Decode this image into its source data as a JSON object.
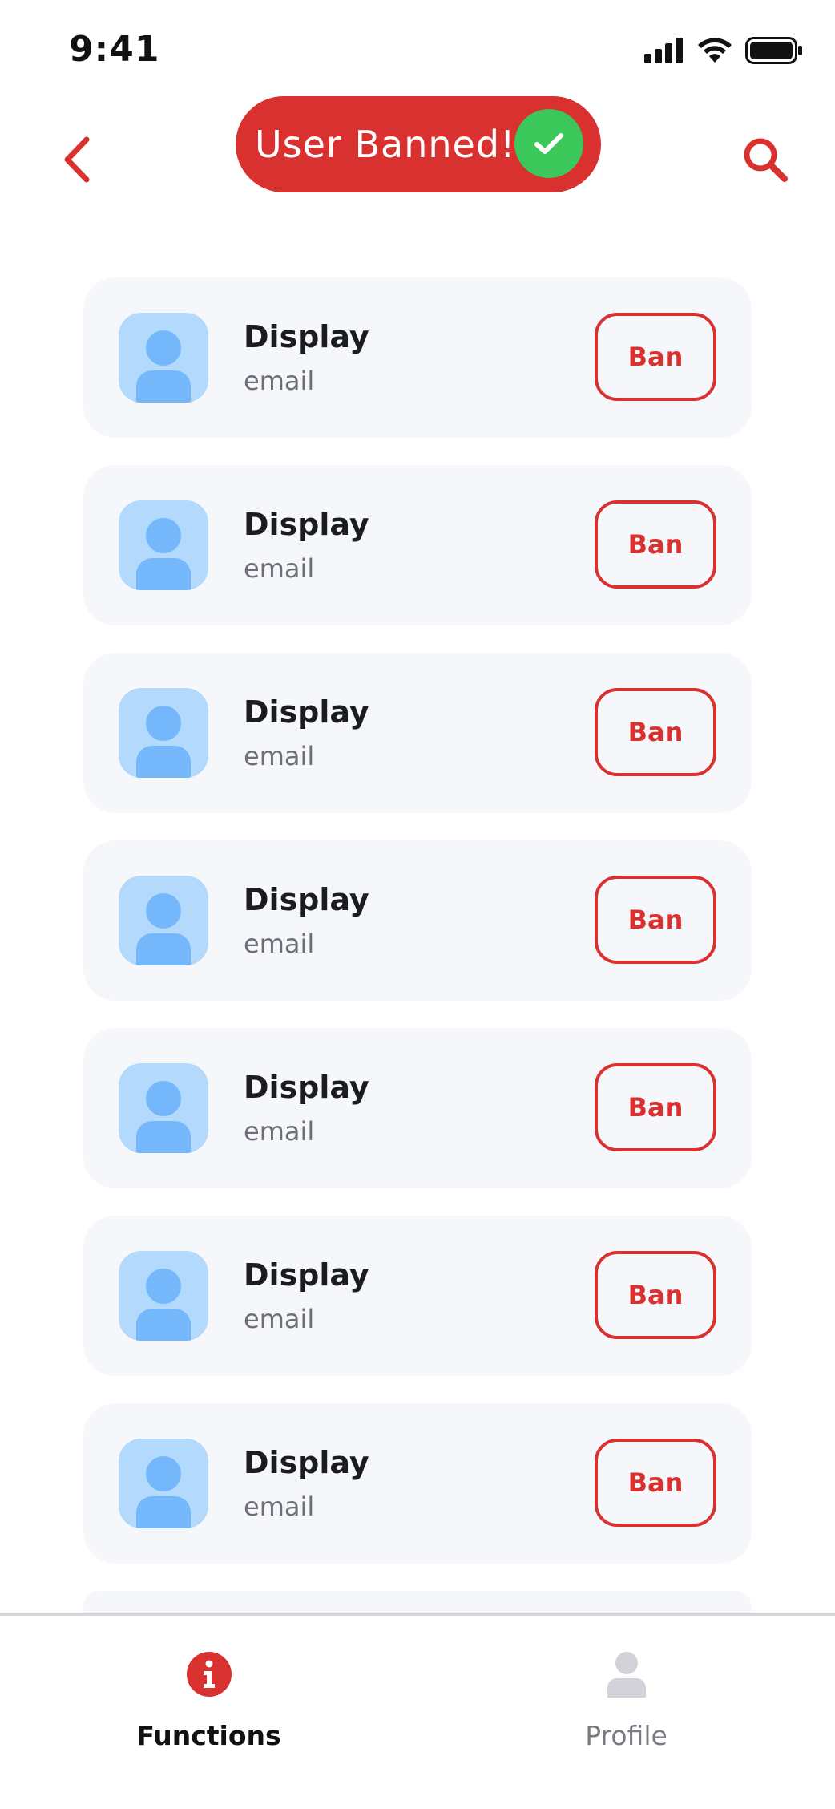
{
  "status_bar": {
    "time": "9:41"
  },
  "header": {
    "toast_text": "User Banned!"
  },
  "users": [
    {
      "name": "Display",
      "email": "email",
      "action_label": "Ban"
    },
    {
      "name": "Display",
      "email": "email",
      "action_label": "Ban"
    },
    {
      "name": "Display",
      "email": "email",
      "action_label": "Ban"
    },
    {
      "name": "Display",
      "email": "email",
      "action_label": "Ban"
    },
    {
      "name": "Display",
      "email": "email",
      "action_label": "Ban"
    },
    {
      "name": "Display",
      "email": "email",
      "action_label": "Ban"
    },
    {
      "name": "Display",
      "email": "email",
      "action_label": "Ban"
    }
  ],
  "tab_bar": {
    "tabs": [
      {
        "label": "Functions",
        "icon": "info-icon",
        "active": true
      },
      {
        "label": "Profile",
        "icon": "person-icon",
        "active": false
      }
    ]
  },
  "colors": {
    "accent": "#d9312f",
    "success": "#3bc75a",
    "card_bg": "#f6f7fb",
    "avatar_bg": "#b3d9fc",
    "avatar_fg": "#74b8fb"
  }
}
